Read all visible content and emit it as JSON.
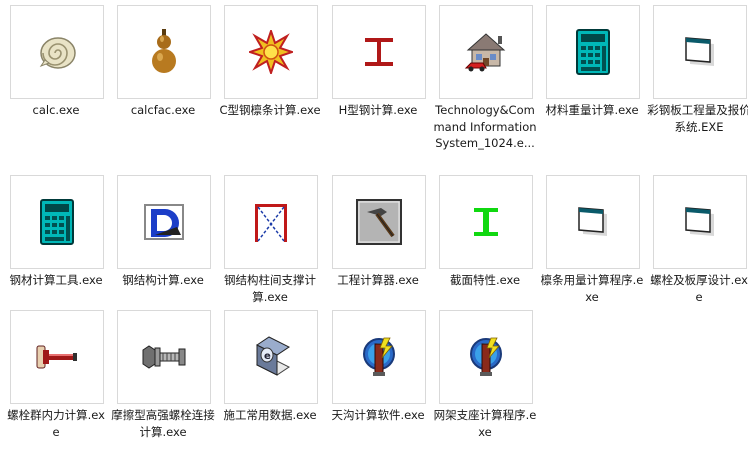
{
  "files": [
    {
      "name": "calc.exe",
      "icon": "shell-icon"
    },
    {
      "name": "calcfac.exe",
      "icon": "gourd-icon"
    },
    {
      "name": "C型钢檩条计算.exe",
      "icon": "star-burst-icon"
    },
    {
      "name": "H型钢计算.exe",
      "icon": "i-beam-red-icon"
    },
    {
      "name": "Technology&Command Information System_1024.e...",
      "icon": "house-car-icon"
    },
    {
      "name": "材料重量计算.exe",
      "icon": "calculator-icon"
    },
    {
      "name": "彩钢板工程量及报价系统.EXE",
      "icon": "window-exe-icon"
    },
    {
      "name": "钢材计算工具.exe",
      "icon": "calculator-icon"
    },
    {
      "name": "钢结构计算.exe",
      "icon": "d-logo-icon"
    },
    {
      "name": "钢结构柱间支撑计算.exe",
      "icon": "bracing-icon"
    },
    {
      "name": "工程计算器.exe",
      "icon": "hammer-icon"
    },
    {
      "name": "截面特性.exe",
      "icon": "i-beam-green-icon"
    },
    {
      "name": "檩条用量计算程序.exe",
      "icon": "window-exe-icon"
    },
    {
      "name": "螺栓及板厚设计.exe",
      "icon": "window-exe-icon"
    },
    {
      "name": "螺栓群内力计算.exe",
      "icon": "bolt-icon"
    },
    {
      "name": "摩擦型高强螺栓连接计算.exe",
      "icon": "hex-bolt-icon"
    },
    {
      "name": "施工常用数据.exe",
      "icon": "book-e-icon"
    },
    {
      "name": "天沟计算软件.exe",
      "icon": "pillar-lightning-icon"
    },
    {
      "name": "网架支座计算程序.exe",
      "icon": "pillar-lightning-icon"
    }
  ]
}
